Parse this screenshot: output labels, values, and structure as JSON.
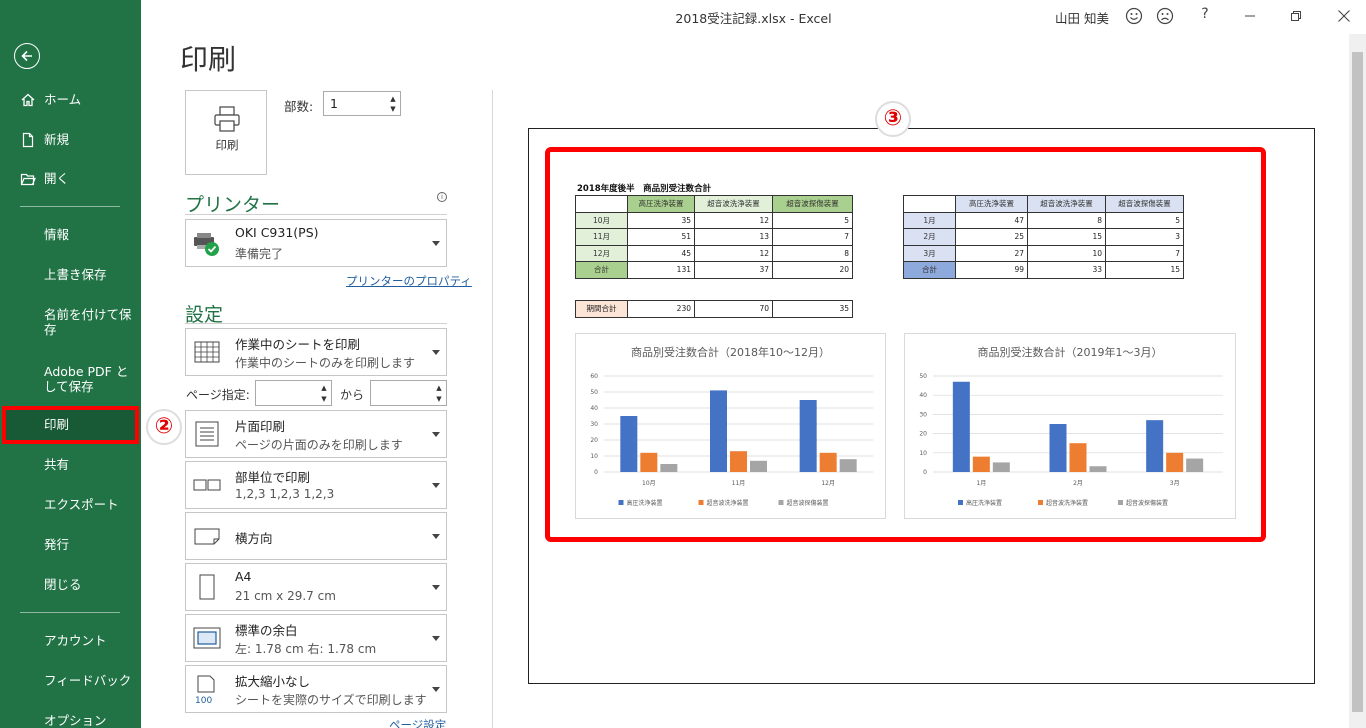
{
  "window": {
    "title": "2018受注記録.xlsx  -  Excel",
    "user": "山田 知美",
    "help": "?"
  },
  "sidebar": {
    "home": "ホーム",
    "new": "新規",
    "open": "開く",
    "info": "情報",
    "save": "上書き保存",
    "save_as": "名前を付けて保存",
    "save_pdf": "Adobe PDF として保存",
    "print": "印刷",
    "share": "共有",
    "export": "エクスポート",
    "publish": "発行",
    "close": "閉じる",
    "account": "アカウント",
    "feedback": "フィードバック",
    "options": "オプション"
  },
  "print_panel": {
    "title": "印刷",
    "print_button": "印刷",
    "copies_label": "部数:",
    "copies_value": "1",
    "printer_heading": "プリンター",
    "printer_name": "OKI C931(PS)",
    "printer_status": "準備完了",
    "printer_props": "プリンターのプロパティ",
    "settings_heading": "設定",
    "scope_main": "作業中のシートを印刷",
    "scope_sub": "作業中のシートのみを印刷します",
    "pages_label": "ページ指定:",
    "pages_to": "から",
    "sides_main": "片面印刷",
    "sides_sub": "ページの片面のみを印刷します",
    "collate_main": "部単位で印刷",
    "collate_sub": "1,2,3    1,2,3    1,2,3",
    "orientation": "横方向",
    "paper_main": "A4",
    "paper_sub": "21 cm x 29.7 cm",
    "margins_main": "標準の余白",
    "margins_sub": "左:  1.78 cm    右:  1.78 cm",
    "scaling_main": "拡大縮小なし",
    "scaling_sub": "シートを実際のサイズで印刷します",
    "scaling_icon_text": "100",
    "page_setup": "ページ設定"
  },
  "annotations": {
    "badge2": "②",
    "badge3": "③"
  },
  "sheet": {
    "title": "2018年度後半　商品別受注数合計",
    "headers": [
      "高圧洗浄装置",
      "超音波洗浄装置",
      "超音波探傷装置"
    ],
    "rows1": [
      {
        "label": "10月",
        "v": [
          "35",
          "12",
          "5"
        ]
      },
      {
        "label": "11月",
        "v": [
          "51",
          "13",
          "7"
        ]
      },
      {
        "label": "12月",
        "v": [
          "45",
          "12",
          "8"
        ]
      },
      {
        "label": "合計",
        "v": [
          "131",
          "37",
          "20"
        ]
      }
    ],
    "rows2": [
      {
        "label": "1月",
        "v": [
          "47",
          "8",
          "5"
        ]
      },
      {
        "label": "2月",
        "v": [
          "25",
          "15",
          "3"
        ]
      },
      {
        "label": "3月",
        "v": [
          "27",
          "10",
          "7"
        ]
      },
      {
        "label": "合計",
        "v": [
          "99",
          "33",
          "15"
        ]
      }
    ],
    "period_total": {
      "label": "期間合計",
      "v": [
        "230",
        "70",
        "35"
      ]
    }
  },
  "chart_data": [
    {
      "type": "bar",
      "title": "商品別受注数合計（2018年10～12月）",
      "categories": [
        "10月",
        "11月",
        "12月"
      ],
      "series": [
        {
          "name": "高圧洗浄装置",
          "values": [
            35,
            51,
            45
          ],
          "color": "#4472c4"
        },
        {
          "name": "超音波洗浄装置",
          "values": [
            12,
            13,
            12
          ],
          "color": "#ed7d31"
        },
        {
          "name": "超音波探傷装置",
          "values": [
            5,
            7,
            8
          ],
          "color": "#a5a5a5"
        }
      ],
      "ylim": [
        0,
        60
      ],
      "yticks": [
        0,
        10,
        20,
        30,
        40,
        50,
        60
      ],
      "grid": true,
      "legend": "bottom"
    },
    {
      "type": "bar",
      "title": "商品別受注数合計（2019年1～3月）",
      "categories": [
        "1月",
        "2月",
        "3月"
      ],
      "series": [
        {
          "name": "高圧洗浄装置",
          "values": [
            47,
            25,
            27
          ],
          "color": "#4472c4"
        },
        {
          "name": "超音波洗浄装置",
          "values": [
            8,
            15,
            10
          ],
          "color": "#ed7d31"
        },
        {
          "name": "超音波探傷装置",
          "values": [
            5,
            3,
            7
          ],
          "color": "#a5a5a5"
        }
      ],
      "ylim": [
        0,
        50
      ],
      "yticks": [
        0,
        10,
        20,
        30,
        40,
        50
      ],
      "grid": true,
      "legend": "bottom"
    }
  ]
}
